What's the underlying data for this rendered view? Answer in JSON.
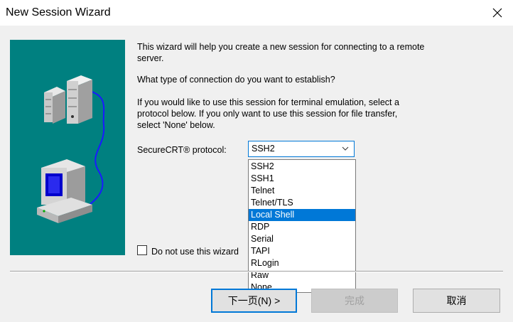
{
  "window": {
    "title": "New Session Wizard",
    "close_icon": "close-icon"
  },
  "intro": {
    "line1": "This wizard will help you create a new session for connecting to a remote",
    "line2": "server.",
    "question": "What type of connection do you want to establish?",
    "hint_line1": "If you would like to use this session for terminal emulation, select a",
    "hint_line2": "protocol below.  If you only want to use this session for file transfer,",
    "hint_line3": "select 'None' below."
  },
  "protocol": {
    "label": "SecureCRT® protocol:",
    "selected": "SSH2",
    "highlighted": "Local Shell",
    "options": [
      "SSH2",
      "SSH1",
      "Telnet",
      "Telnet/TLS",
      "Local Shell",
      "RDP",
      "Serial",
      "TAPI",
      "RLogin",
      "Raw",
      "None"
    ]
  },
  "skip_wizard": {
    "label": "Do not use this wizard",
    "checked": false
  },
  "buttons": {
    "next": "下一页(N) >",
    "finish": "完成",
    "cancel": "取消"
  },
  "colors": {
    "illustration_bg": "#008080",
    "accent": "#0078d7"
  }
}
